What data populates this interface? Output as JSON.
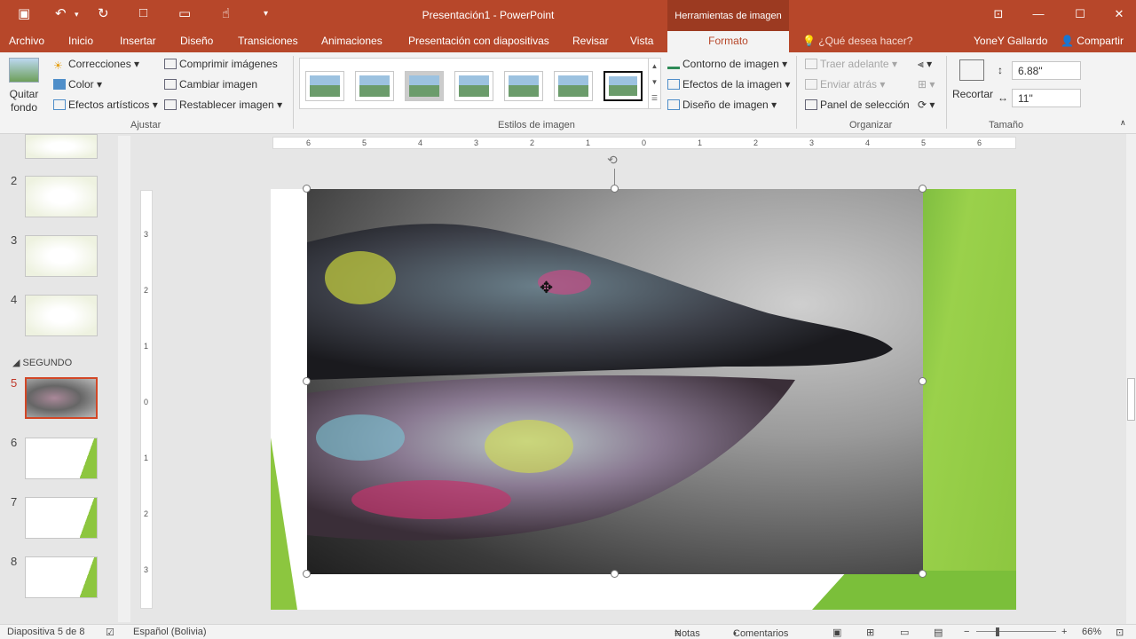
{
  "window": {
    "title": "Presentación1 - PowerPoint",
    "context_tab_group": "Herramientas de imagen",
    "user": "YoneY Gallardo",
    "share": "Compartir",
    "tell_me": "¿Qué desea hacer?"
  },
  "tabs": [
    "Archivo",
    "Inicio",
    "Insertar",
    "Diseño",
    "Transiciones",
    "Animaciones",
    "Presentación con diapositivas",
    "Revisar",
    "Vista",
    "Formato"
  ],
  "ribbon": {
    "ajustar": {
      "label": "Ajustar",
      "quitar_fondo": "Quitar fondo",
      "correcciones": "Correcciones",
      "color": "Color",
      "efectos_artisticos": "Efectos artísticos",
      "comprimir": "Comprimir imágenes",
      "cambiar": "Cambiar imagen",
      "restablecer": "Restablecer imagen"
    },
    "estilos": {
      "label": "Estilos de imagen",
      "contorno": "Contorno de imagen",
      "efectos": "Efectos de la imagen",
      "diseno": "Diseño de imagen"
    },
    "organizar": {
      "label": "Organizar",
      "traer_adelante": "Traer adelante",
      "enviar_atras": "Enviar atrás",
      "panel_seleccion": "Panel de selección"
    },
    "tamano": {
      "label": "Tamaño",
      "recortar": "Recortar",
      "height": "6.88\"",
      "width": "11\""
    }
  },
  "ruler": {
    "horizontal": [
      "6",
      "5",
      "4",
      "3",
      "2",
      "1",
      "0",
      "1",
      "2",
      "3",
      "4",
      "5",
      "6"
    ],
    "vertical": [
      "3",
      "2",
      "1",
      "0",
      "1",
      "2",
      "3"
    ]
  },
  "slides_panel": {
    "section": "SEGUNDO",
    "slides": [
      {
        "num": "2"
      },
      {
        "num": "3"
      },
      {
        "num": "4"
      },
      {
        "num": "5"
      },
      {
        "num": "6"
      },
      {
        "num": "7"
      },
      {
        "num": "8"
      }
    ]
  },
  "status": {
    "slide_info": "Diapositiva 5 de 8",
    "language": "Español (Bolivia)",
    "notes": "Notas",
    "comments": "Comentarios",
    "zoom": "66%"
  }
}
